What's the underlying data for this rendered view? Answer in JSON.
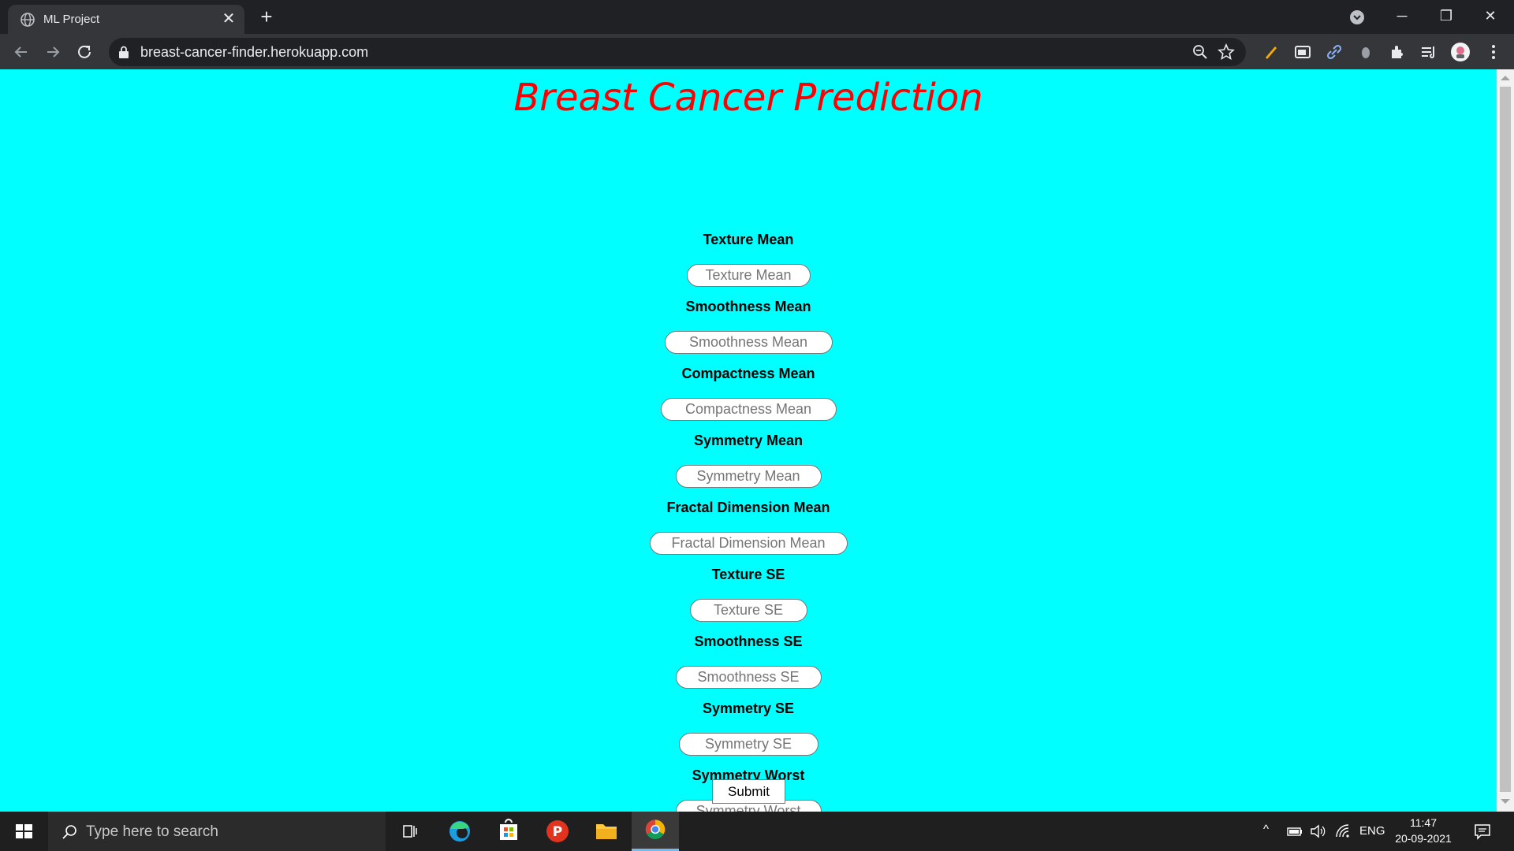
{
  "browser": {
    "tab_title": "ML Project",
    "url": "breast-cancer-finder.herokuapp.com"
  },
  "page": {
    "heading": "Breast Cancer Prediction",
    "fields": [
      {
        "label": "Texture Mean",
        "placeholder": "Texture Mean",
        "value": ""
      },
      {
        "label": "Smoothness Mean",
        "placeholder": "Smoothness Mean",
        "value": ""
      },
      {
        "label": "Compactness Mean",
        "placeholder": "Compactness Mean",
        "value": ""
      },
      {
        "label": "Symmetry Mean",
        "placeholder": "Symmetry Mean",
        "value": ""
      },
      {
        "label": "Fractal Dimension Mean",
        "placeholder": "Fractal Dimension Mean",
        "value": ""
      },
      {
        "label": "Texture SE",
        "placeholder": "Texture SE",
        "value": ""
      },
      {
        "label": "Smoothness SE",
        "placeholder": "Smoothness SE",
        "value": ""
      },
      {
        "label": "Symmetry SE",
        "placeholder": "Symmetry SE",
        "value": ""
      },
      {
        "label": "Symmetry Worst",
        "placeholder": "Symmetry Worst",
        "value": ""
      }
    ],
    "submit_label": "Submit"
  },
  "taskbar": {
    "search_placeholder": "Type here to search",
    "language": "ENG",
    "time": "11:47",
    "date": "20-09-2021"
  },
  "colors": {
    "page_background": "#00ffff",
    "heading": "#ff0000"
  }
}
